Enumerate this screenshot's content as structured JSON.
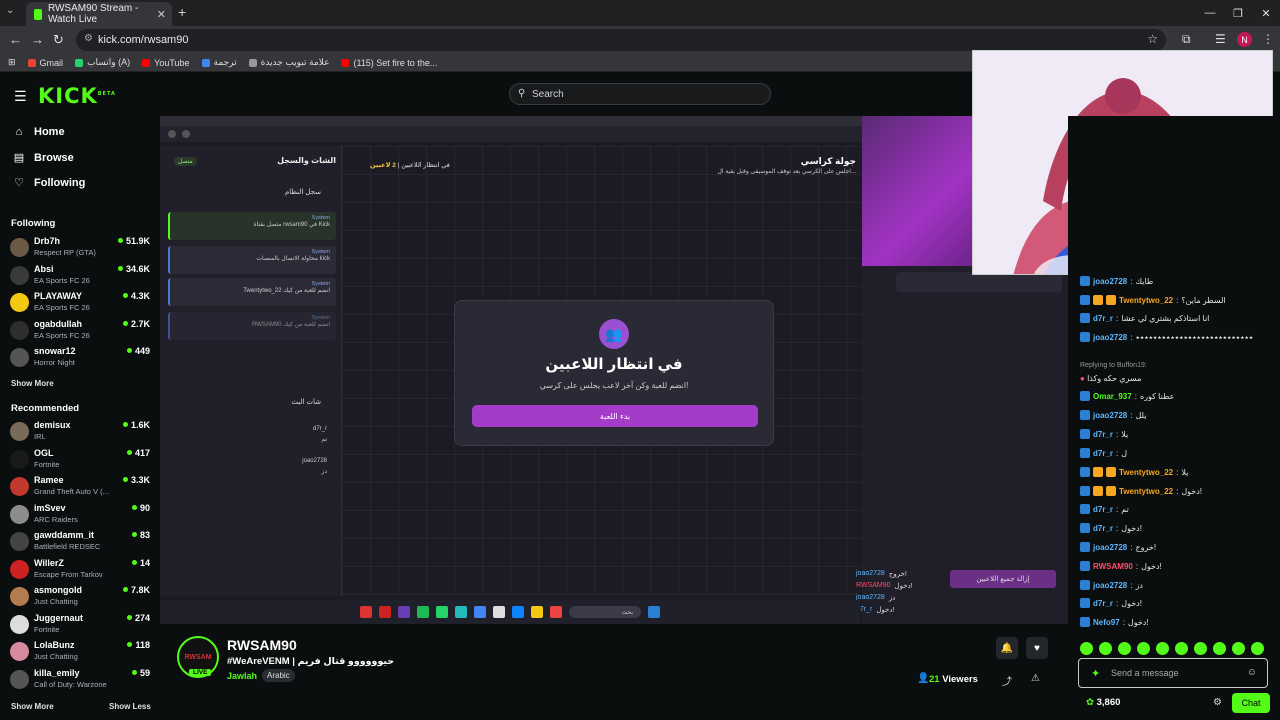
{
  "browser": {
    "tab_title": "RWSAM90 Stream - Watch Live",
    "url": "kick.com/rwsam90",
    "profile_initial": "N",
    "bookmarks": [
      {
        "label": "Gmail",
        "color": "#ea4335"
      },
      {
        "label": "واتساب (A)",
        "color": "#25d366"
      },
      {
        "label": "YouTube",
        "color": "#ff0000"
      },
      {
        "label": "ترجمة",
        "color": "#4285f4"
      },
      {
        "label": "علامة تبويب جديدة",
        "color": "#999999"
      },
      {
        "label": "(115) Set fire to the...",
        "color": "#ff0000"
      }
    ]
  },
  "header": {
    "logo": "KICK",
    "logo_sup": "BETA",
    "search_placeholder": "Search"
  },
  "sidebar": {
    "nav": [
      {
        "label": "Home",
        "icon": "home-icon"
      },
      {
        "label": "Browse",
        "icon": "browse-icon"
      },
      {
        "label": "Following",
        "icon": "heart-icon"
      }
    ],
    "following_title": "Following",
    "following": [
      {
        "name": "Drb7h",
        "game": "Respect RP (GTA)",
        "viewers": "51.9K",
        "color": "#6b5a46"
      },
      {
        "name": "Absi",
        "game": "EA Sports FC 26",
        "viewers": "34.6K",
        "color": "#3a3a3a"
      },
      {
        "name": "PLAYAWAY",
        "game": "EA Sports FC 26",
        "viewers": "4.3K",
        "color": "#f2c811"
      },
      {
        "name": "ogabdullah",
        "game": "EA Sports FC 26",
        "viewers": "2.7K",
        "color": "#2e2e2e"
      },
      {
        "name": "snowar12",
        "game": "Horror Night",
        "viewers": "449",
        "color": "#555555"
      }
    ],
    "show_more_1": "Show More",
    "recommended_title": "Recommended",
    "recommended": [
      {
        "name": "demisux",
        "game": "IRL",
        "viewers": "1.6K",
        "color": "#7a6a5a"
      },
      {
        "name": "OGL",
        "game": "Fortnite",
        "viewers": "417",
        "color": "#1a1a1a"
      },
      {
        "name": "Ramee",
        "game": "Grand Theft Auto V (...",
        "viewers": "3.3K",
        "color": "#c0392b"
      },
      {
        "name": "imSvev",
        "game": "ARC Raiders",
        "viewers": "90",
        "color": "#8c8c8c"
      },
      {
        "name": "gawddamm_it",
        "game": "Battlefield REDSEC",
        "viewers": "83",
        "color": "#444444"
      },
      {
        "name": "WillerZ",
        "game": "Escape From Tarkov",
        "viewers": "14",
        "color": "#cc2222"
      },
      {
        "name": "asmongold",
        "game": "Just Chatting",
        "viewers": "7.8K",
        "color": "#b37b4e"
      },
      {
        "name": "Juggernaut",
        "game": "Fortnite",
        "viewers": "274",
        "color": "#dddddd"
      },
      {
        "name": "LolaBunz",
        "game": "Just Chatting",
        "viewers": "118",
        "color": "#d68a9e"
      },
      {
        "name": "killa_emily",
        "game": "Call of Duty: Warzone",
        "viewers": "59",
        "color": "#555555"
      }
    ],
    "show_more_2": "Show More",
    "show_less": "Show Less"
  },
  "stream_content": {
    "app_panel_title": "الشات والسجل",
    "connected_tag": "متصل",
    "log_title": "سجل النظام",
    "log_cards": [
      {
        "sender": "System",
        "text": "متصل بقناة rwsam90 في Kick"
      },
      {
        "sender": "System",
        "text": "محاولة الاتصال بالمنصات kick"
      },
      {
        "sender": "System",
        "text": "Twentytwo_22 انضم للعبة من كيك"
      },
      {
        "sender": "System",
        "text": "RWSAM90 انضم للعبة من كيك"
      }
    ],
    "live_chat_title": "شات البث",
    "mini_msgs": [
      {
        "user": "d7r_r",
        "text": "تم"
      },
      {
        "user": "joao2728",
        "text": "دز"
      }
    ],
    "round_title": "جولة كراسي",
    "round_sub": "اجلس على الكرسي بعد توقف الموسيقى وقبل بقية ال...",
    "status_text": "في انتظار اللاعبين",
    "players_count": "2 لاعبين",
    "modal_title": "في انتظار اللاعبين",
    "modal_sub": "انضم للعبة وكن آخر لاعب يجلس على كرسي!",
    "modal_button": "بدء اللعبة",
    "clear_button": "إزالة جميع اللاعبين",
    "player_rows": [
      {
        "user": "joao2728",
        "text": "خروج!"
      },
      {
        "user": "RWSAM90",
        "text": "دخول!"
      },
      {
        "user": "joao2728",
        "text": "دز"
      },
      {
        "user": "d7r_r",
        "text": "دخول!"
      }
    ],
    "taskbar_search": "بحث"
  },
  "streamer": {
    "name": "RWSAM90",
    "title": "#WeAreVENM | حيوووووو قتال فريم",
    "category": "Jawlah",
    "language": "Arabic",
    "live": "LIVE",
    "viewers_count": "21",
    "viewers_label": "Viewers",
    "avatar_text": "RWSAM"
  },
  "chat": {
    "messages": [
      {
        "user": "joao2728",
        "text": "طايك",
        "color": "#5cb8ff",
        "crown": false
      },
      {
        "user": "Twentytwo_22",
        "text": "السطر ماين؟",
        "color": "#f5a623",
        "crown": true
      },
      {
        "user": "d7r_r",
        "text": "انا استاذكم بشتري لي عشا",
        "color": "#5cb8ff",
        "crown": false
      },
      {
        "user": "joao2728",
        "text": "٭٭٭٭٭٭٭٭٭٭٭٭٭٭٭٭٭٭٭٭٭٭٭٭٭٭٭",
        "color": "#5cb8ff",
        "crown": false
      },
      {
        "user": "Omar_937",
        "text": "عطنا كوره",
        "color": "#53fc18",
        "crown": false
      },
      {
        "user": "joao2728",
        "text": "يلل",
        "color": "#5cb8ff",
        "crown": false
      },
      {
        "user": "d7r_r",
        "text": "يلا",
        "color": "#5cb8ff",
        "crown": false
      },
      {
        "user": "d7r_r",
        "text": "ل",
        "color": "#5cb8ff",
        "crown": false
      },
      {
        "user": "Twentytwo_22",
        "text": "يلا",
        "color": "#f5a623",
        "crown": true
      },
      {
        "user": "Twentytwo_22",
        "text": "دخول!",
        "color": "#f5a623",
        "crown": true
      },
      {
        "user": "d7r_r",
        "text": "تم",
        "color": "#5cb8ff",
        "crown": false
      },
      {
        "user": "d7r_r",
        "text": "دخول!",
        "color": "#5cb8ff",
        "crown": false
      },
      {
        "user": "joao2728",
        "text": "خروج!",
        "color": "#5cb8ff",
        "crown": false
      },
      {
        "user": "RWSAM90",
        "text": "دخول!",
        "color": "#ff4d6d",
        "crown": false
      },
      {
        "user": "joao2728",
        "text": "دز",
        "color": "#5cb8ff",
        "crown": false
      },
      {
        "user": "d7r_r",
        "text": "دخول!",
        "color": "#5cb8ff",
        "crown": false
      },
      {
        "user": "Nefo97",
        "text": "دخول!",
        "color": "#5cb8ff",
        "crown": false
      }
    ],
    "reply_to": "Replying to Buffon19:",
    "reply_text": "مسري حكه وكذا",
    "input_placeholder": "Send a message",
    "points": "3,860",
    "chat_button": "Chat"
  }
}
